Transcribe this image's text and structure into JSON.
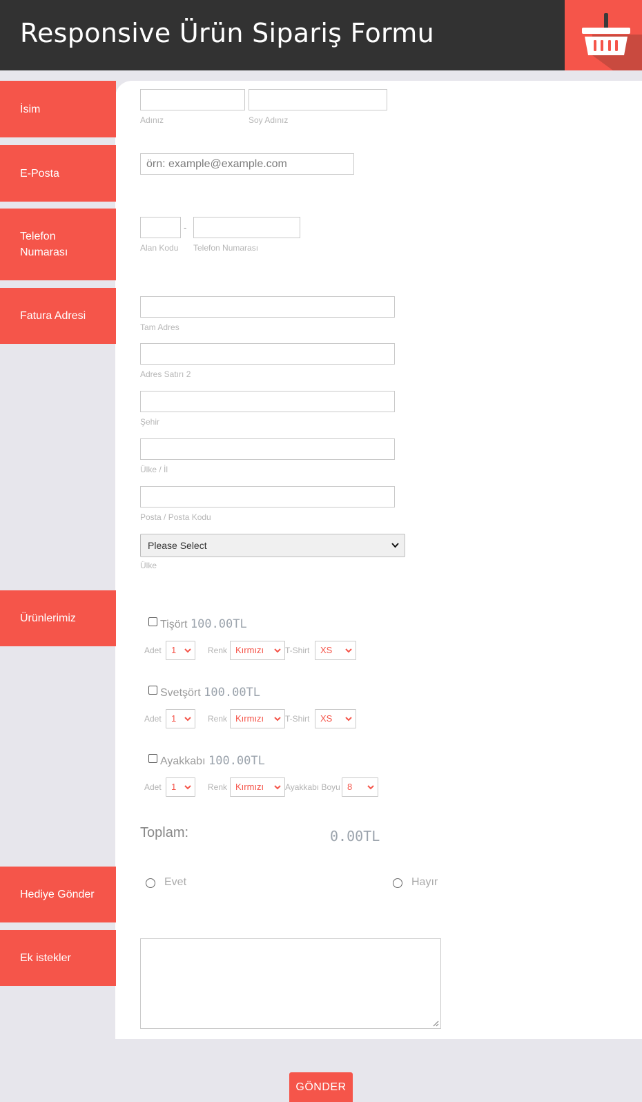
{
  "header": {
    "title": "Responsive Ürün Sipariş Formu",
    "icon": "basket-icon",
    "accent": "#f5554a",
    "bg": "#323232"
  },
  "labels": {
    "name": "İsim",
    "email": "E-Posta",
    "phone": "Telefon Numarası",
    "address": "Fatura Adresi",
    "products": "Ürünlerimiz",
    "gift": "Hediye Gönder",
    "extra": "Ek istekler"
  },
  "name_fields": {
    "first_sub": "Adınız",
    "last_sub": "Soy Adınız"
  },
  "email_field": {
    "placeholder": "örn: example@example.com"
  },
  "phone_fields": {
    "separator": "-",
    "area_sub": "Alan Kodu",
    "number_sub": "Telefon Numarası"
  },
  "address_fields": {
    "line1_sub": "Tam Adres",
    "line2_sub": "Adres Satırı 2",
    "city_sub": "Şehir",
    "state_sub": "Ülke / İl",
    "zip_sub": "Posta / Posta Kodu",
    "country_value": "Please Select",
    "country_sub": "Ülke"
  },
  "products": [
    {
      "name": "Tişört",
      "price": "100.00TL",
      "qty_label": "Adet",
      "qty": "1",
      "color_label": "Renk",
      "color": "Kırmızı",
      "size_label": "T-Shirt",
      "size": "XS"
    },
    {
      "name": "Svetşört",
      "price": "100.00TL",
      "qty_label": "Adet",
      "qty": "1",
      "color_label": "Renk",
      "color": "Kırmızı",
      "size_label": "T-Shirt",
      "size": "XS"
    },
    {
      "name": "Ayakkabı",
      "price": "100.00TL",
      "qty_label": "Adet",
      "qty": "1",
      "color_label": "Renk",
      "color": "Kırmızı",
      "size_label": "Ayakkabı Boyu",
      "size": "8"
    }
  ],
  "total": {
    "label": "Toplam:",
    "value": "0.00TL"
  },
  "gift_options": {
    "yes": "Evet",
    "no": "Hayır"
  },
  "submit_label": "GÖNDER"
}
